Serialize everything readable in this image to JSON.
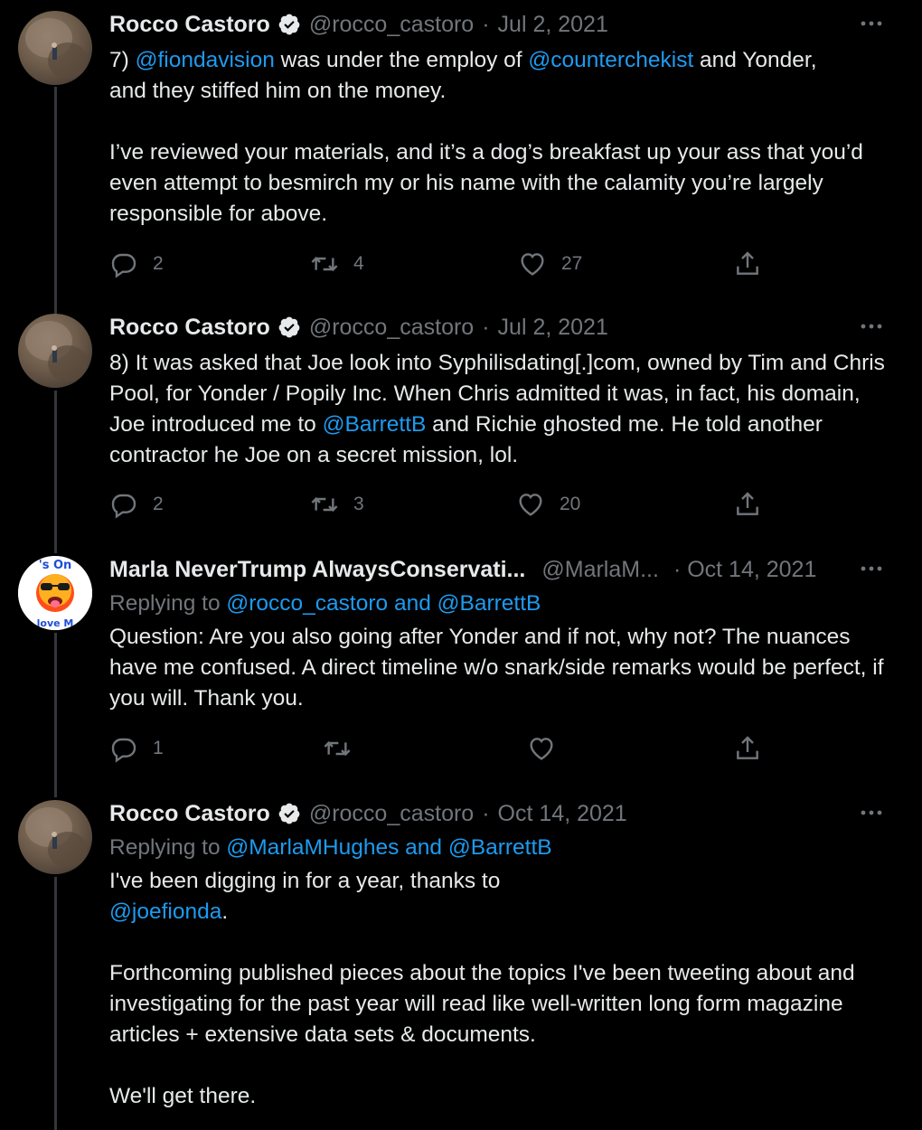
{
  "tweets": [
    {
      "author": "Rocco Castoro",
      "handle": "@rocco_castoro",
      "date": "Jul 2, 2021",
      "verified": true,
      "avatar_icon": "rocco-avatar",
      "text": {
        "line1_prefix": "7) ",
        "mention1": "@fiondavision",
        "line1_mid": " was under the employ of ",
        "mention2": "@counterchekist",
        "line1_suffix": " and Yonder,",
        "line2": "and they stiffed him on the money.",
        "para2": "I’ve reviewed your materials, and it’s a dog’s breakfast up your ass that you’d even attempt to besmirch my or his name with the calamity you’re largely responsible for above."
      },
      "replies": "2",
      "retweets": "4",
      "likes": "27"
    },
    {
      "author": "Rocco Castoro",
      "handle": "@rocco_castoro",
      "date": "Jul 2, 2021",
      "verified": true,
      "text": {
        "part1": "8) It was asked that Joe look into Syphilisdating[.]com, owned by Tim and Chris Pool, for Yonder / Popily Inc. When Chris admitted it was, in fact, his domain, Joe introduced me to ",
        "mention": "@BarrettB",
        "part2": " and Richie ghosted me. He told another contractor he Joe on a secret mission, lol."
      },
      "replies": "2",
      "retweets": "3",
      "likes": "20"
    },
    {
      "author": "Marla NeverTrump AlwaysConservati...",
      "handle": "@MarlaM...",
      "date": "· Oct 14, 2021",
      "verified": false,
      "avatar_text_top": "'s On",
      "avatar_text_bottom": "love M",
      "replying_label": "Replying to ",
      "replying_to": "@rocco_castoro and @BarrettB",
      "text": "Question: Are you also going after Yonder and if not, why not? The nuances have me confused. A direct timeline w/o snark/side remarks would be perfect, if you will. Thank you.",
      "replies": "1",
      "retweets": "",
      "likes": ""
    },
    {
      "author": "Rocco Castoro",
      "handle": "@rocco_castoro",
      "date": "Oct 14, 2021",
      "verified": true,
      "replying_label": "Replying to ",
      "replying_to": "@MarlaMHughes and @BarrettB",
      "text": {
        "line1": "I've been digging in for a year, thanks to",
        "mention": "@joefionda",
        "after_mention": ".",
        "para2": "Forthcoming published pieces about the topics I've been tweeting about and investigating for the past year will read like well-written long form magazine articles + extensive data sets & documents.",
        "para3": "We'll get there."
      }
    }
  ],
  "colors": {
    "background": "#000000",
    "text": "#e7e9ea",
    "secondary": "#71767b",
    "link": "#1d9bf0",
    "thread_line": "#333639"
  }
}
